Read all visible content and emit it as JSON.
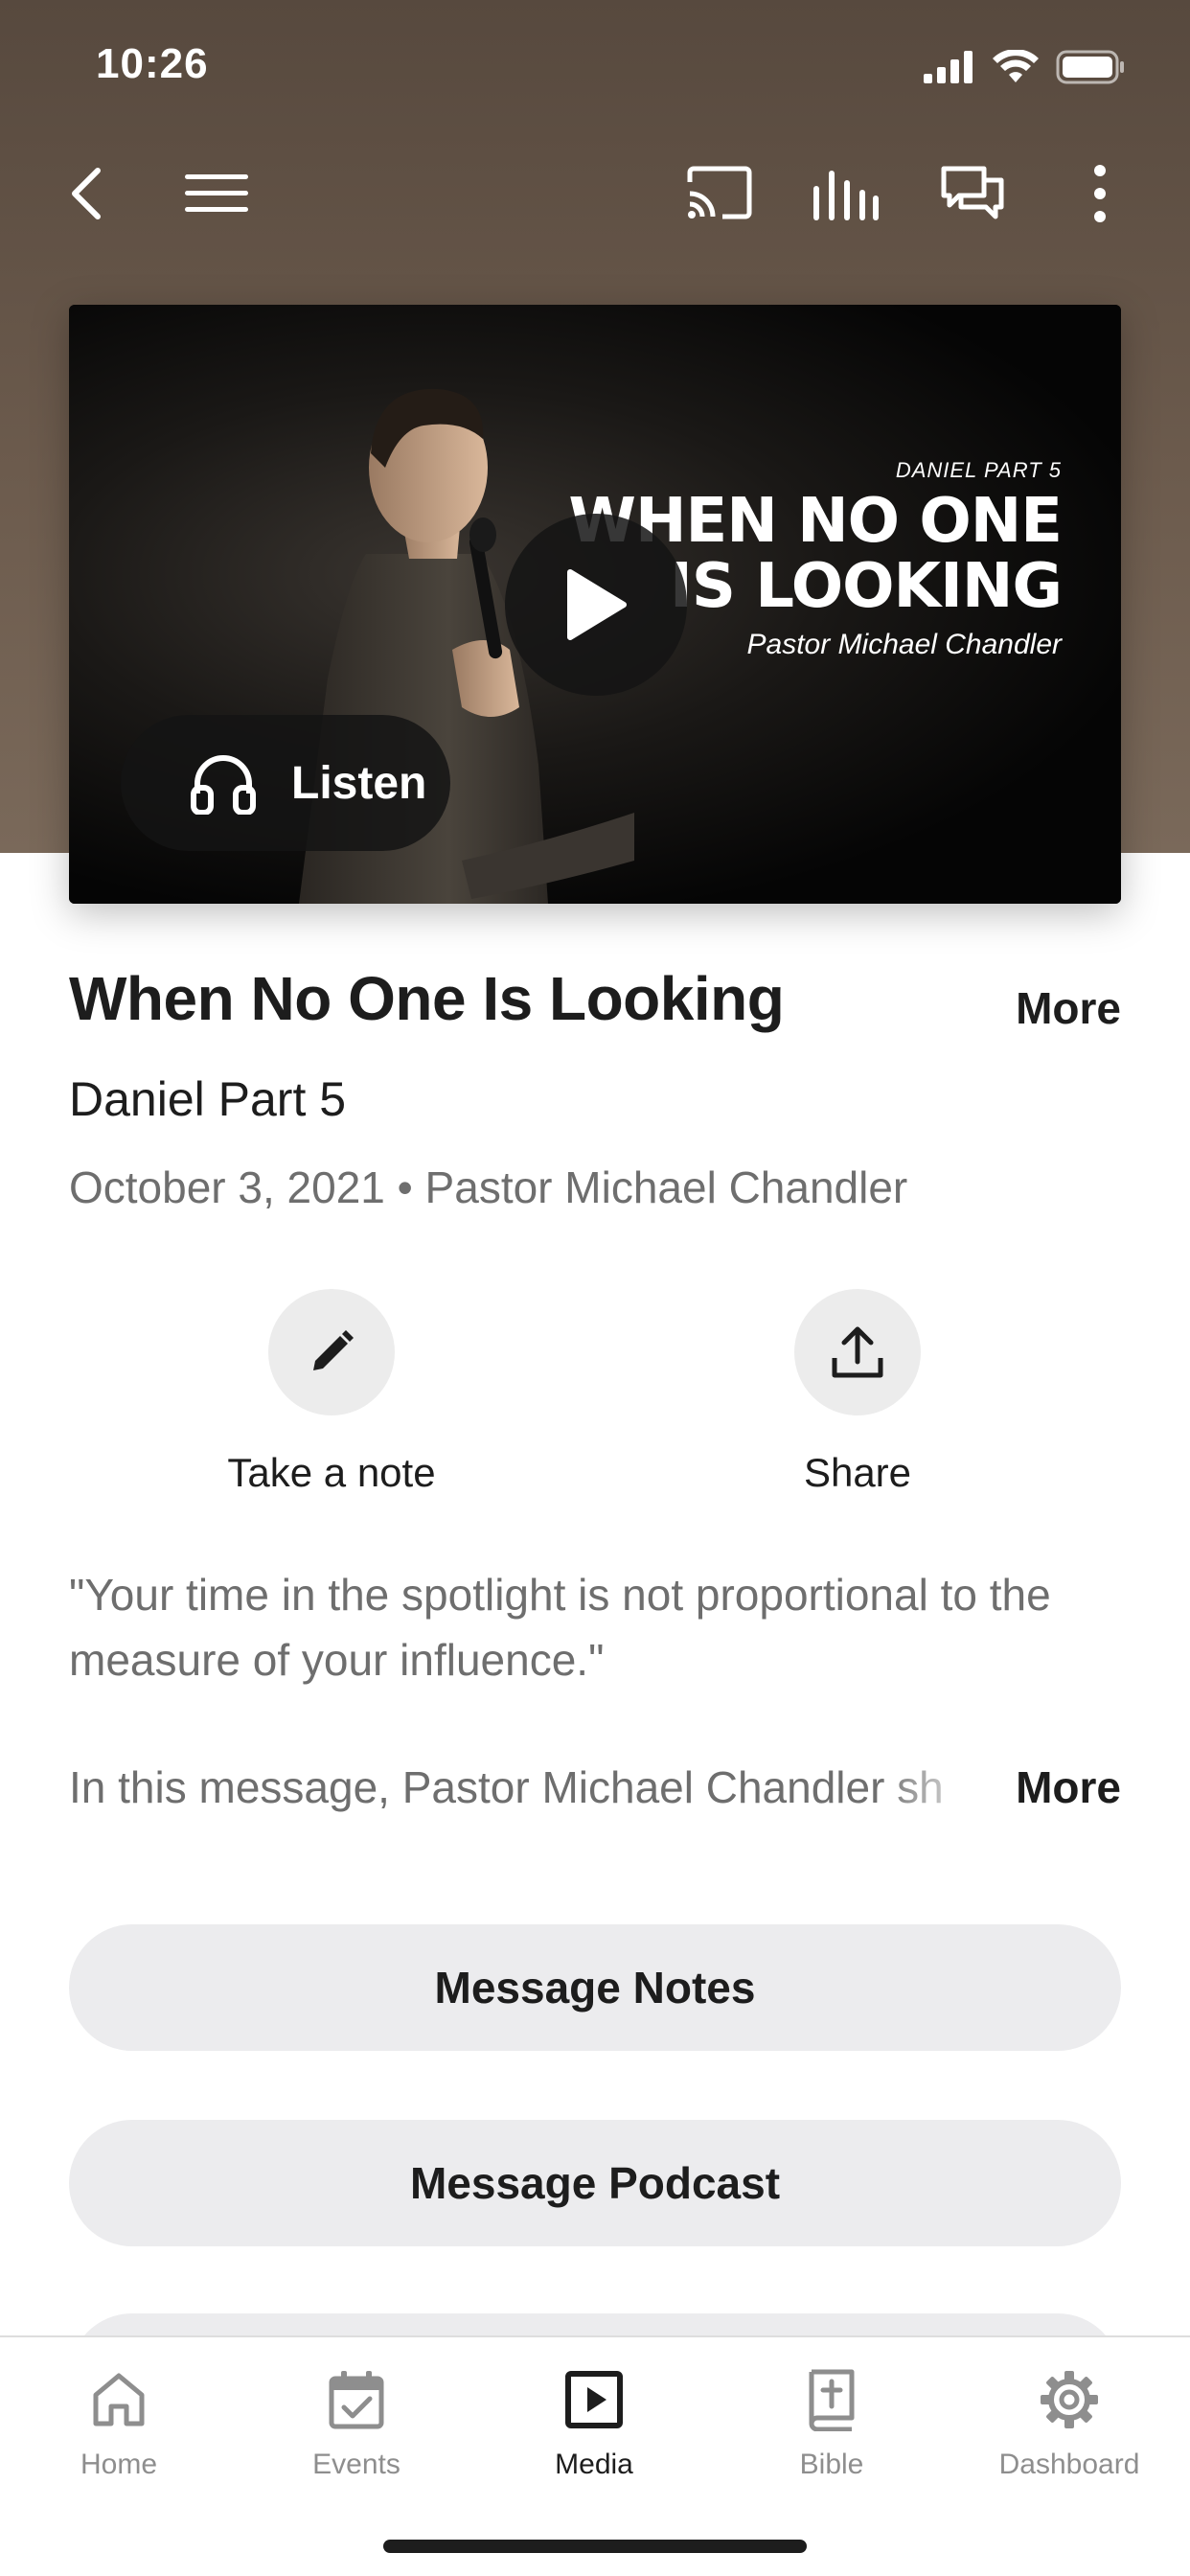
{
  "status_bar": {
    "time": "10:26"
  },
  "media": {
    "art_series": "DANIEL PART 5",
    "art_title_line1": "WHEN NO ONE",
    "art_title_line2": "IS LOOKING",
    "art_speaker": "Pastor Michael Chandler",
    "listen_label": "Listen"
  },
  "message": {
    "title": "When No One Is Looking",
    "title_more": "More",
    "series": "Daniel Part 5",
    "meta": "October 3, 2021 • Pastor Michael Chandler"
  },
  "actions": {
    "note_label": "Take a note",
    "share_label": "Share"
  },
  "description": {
    "quote": "\"Your time in the spotlight is not proportional to the measure of your influence.\"",
    "summary": "In this message, Pastor Michael Chandler sh",
    "more": "More"
  },
  "buttons": {
    "notes": "Message Notes",
    "podcast": "Message Podcast"
  },
  "tab_bar": {
    "items": [
      {
        "label": "Home",
        "icon": "home-icon"
      },
      {
        "label": "Events",
        "icon": "calendar-check-icon"
      },
      {
        "label": "Media",
        "icon": "play-box-icon"
      },
      {
        "label": "Bible",
        "icon": "bible-icon"
      },
      {
        "label": "Dashboard",
        "icon": "gear-icon"
      }
    ],
    "active": "Media"
  },
  "colors": {
    "hero_background": "#6c5b4d",
    "pill_background": "#ececee",
    "muted_text": "#6e6e6e",
    "inactive_tab": "#8e8e8e"
  }
}
